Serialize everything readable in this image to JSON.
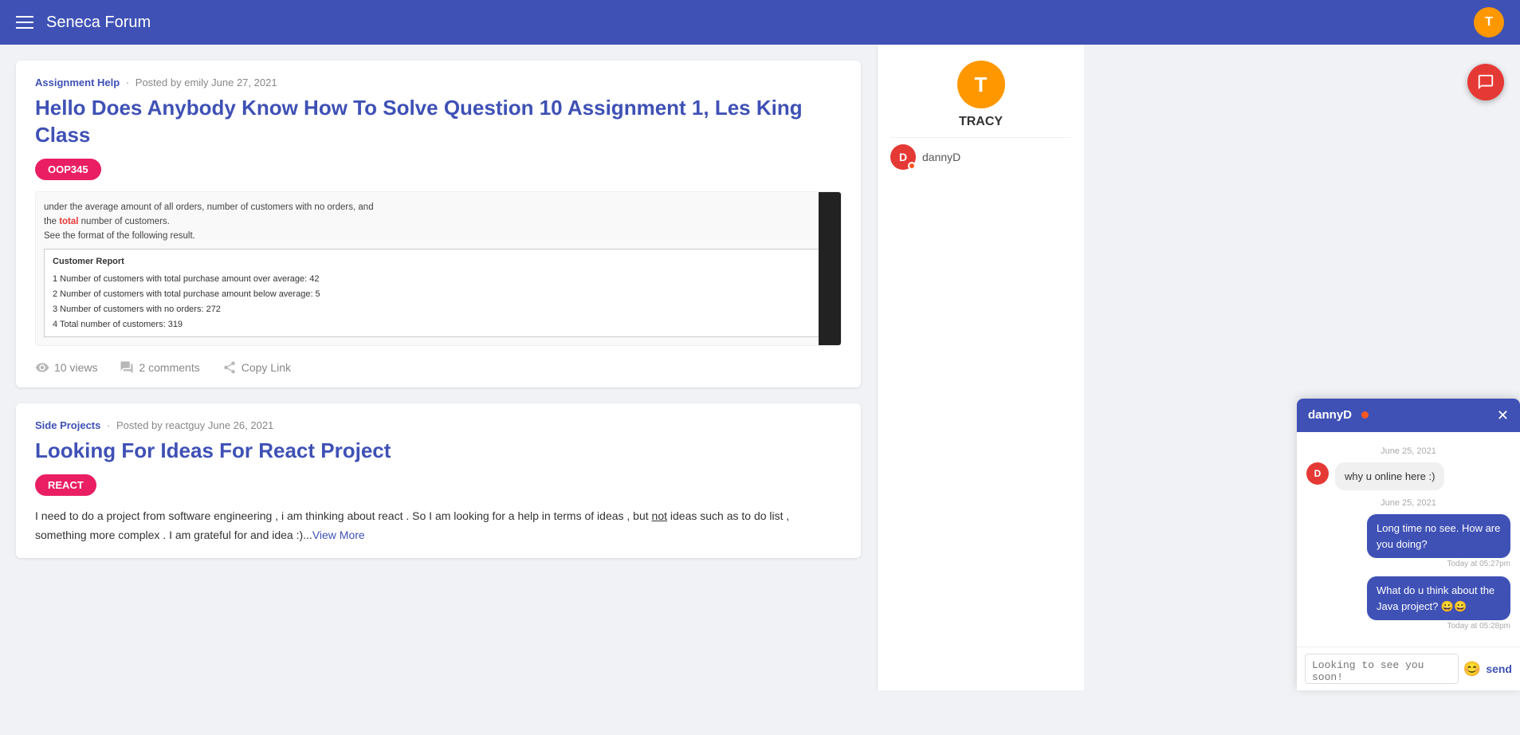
{
  "header": {
    "title": "Seneca Forum",
    "avatar_letter": "T"
  },
  "posts": [
    {
      "id": "post-1",
      "category": "Assignment Help",
      "meta": "Posted by emily June 27, 2021",
      "title": "Hello Does Anybody Know How To Solve Question 10 Assignment 1, Les King Class",
      "tag": "OOP345",
      "image_text_line1": "under the average amount of all orders, number of customers with no orders, and",
      "image_text_line2": "the total number of customers.",
      "image_text_line3": "See the format of the following result.",
      "image_table_title": "Customer Report",
      "image_table_rows": [
        "1 Number of customers with total purchase amount over average: 42",
        "2 Number of customers with total purchase amount below average: 5",
        "3 Number of customers with no orders: 272",
        "4 Total number of customers: 319"
      ],
      "views": "10 views",
      "comments": "2 comments",
      "copy_link": "Copy Link"
    },
    {
      "id": "post-2",
      "category": "Side Projects",
      "meta": "Posted by reactguy June 26, 2021",
      "title": "Looking For Ideas For React Project",
      "tag": "REACT",
      "body": "I need to do a project from software engineering , i am thinking about react . So I am looking for a help in terms of ideas , but not ideas such as to do list , something more complex . I am grateful for and idea :)...",
      "view_more": "View More"
    }
  ],
  "user_panel": {
    "avatar_letter": "T",
    "name": "TRACY",
    "contacts": [
      {
        "letter": "D",
        "name": "dannyD",
        "online": true
      }
    ]
  },
  "chat_window": {
    "contact_name": "dannyD",
    "online": true,
    "messages": [
      {
        "type": "date",
        "text": "June 25, 2021"
      },
      {
        "type": "received",
        "avatar_letter": "D",
        "avatar_color": "#e53935",
        "text": "why u online here :)",
        "time": ""
      },
      {
        "type": "date",
        "text": "June 25, 2021"
      },
      {
        "type": "sent",
        "text": "Long time no see. How are you doing?",
        "time": "Today at 05:27pm"
      },
      {
        "type": "sent",
        "text": "What do u think about the Java project? 😀😀",
        "time": "Today at 05:28pm"
      }
    ],
    "input_placeholder": "Looking to see you soon!",
    "input_value": "Looking to see you soon!",
    "emoji_icon": "😊",
    "send_label": "send"
  },
  "fab": {
    "icon": "💬"
  }
}
